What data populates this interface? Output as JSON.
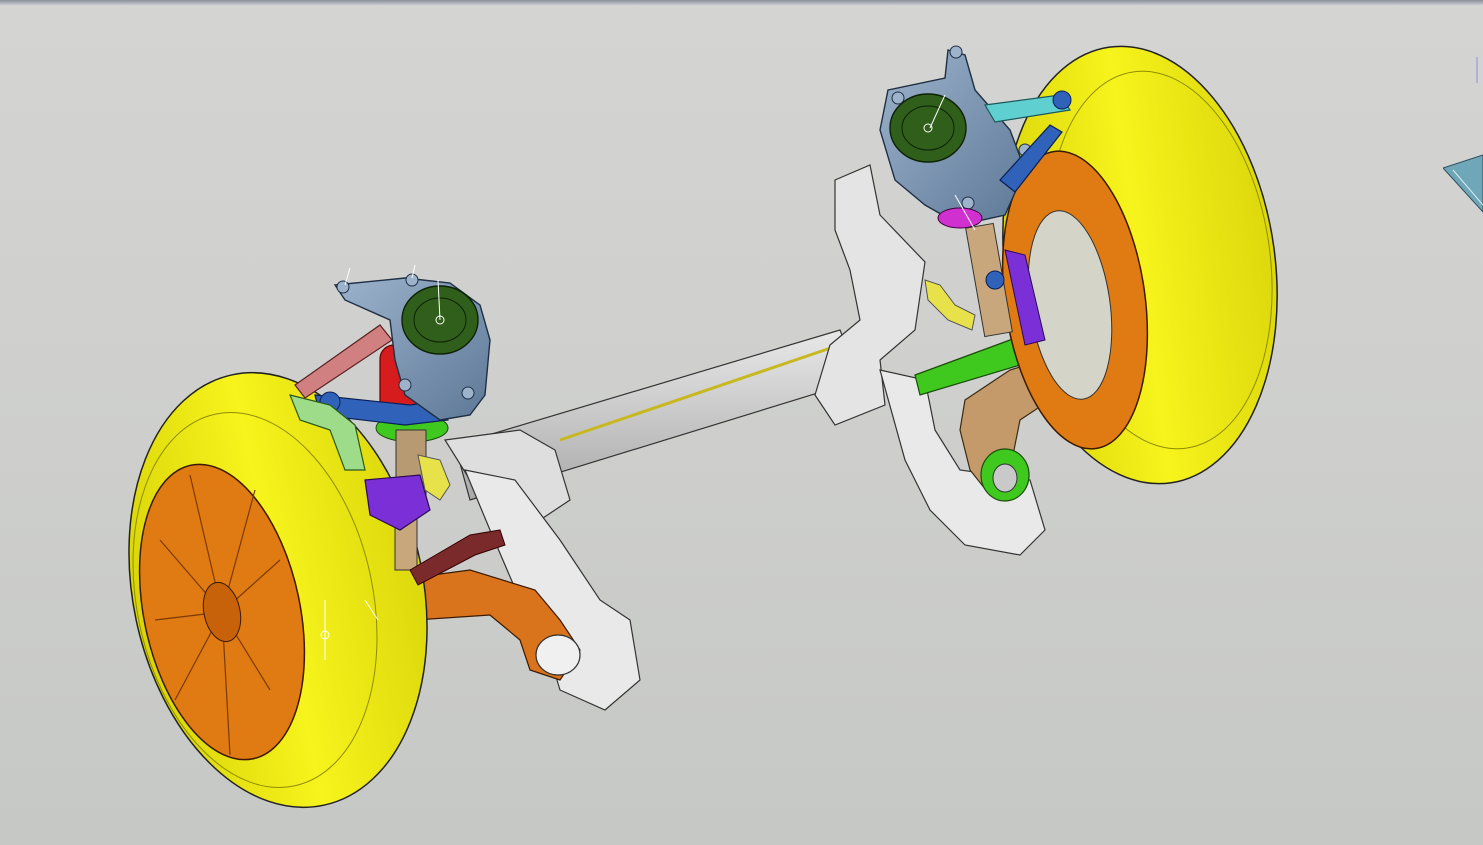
{
  "app": {
    "view": "3d-viewport"
  },
  "colors": {
    "background_top": "#d4d4d2",
    "background_bottom": "#c6c8c6",
    "tire": "#f2ee14",
    "rim": "#e07a12",
    "knuckle": "#7f99b8",
    "bushing": "#2f5f1a",
    "subframe": "#d8d8d8",
    "control_arm_brown": "#c49a6a",
    "lower_arm_orange": "#d9741c",
    "link_blue": "#2f62b8",
    "link_cyan": "#5fcfd0",
    "spring_red": "#d61c1c",
    "link_green": "#3fc81e",
    "link_purple": "#7b2fd6",
    "link_pink": "#d08080",
    "stabilizer_yellow": "#e8e24a",
    "compass": "#6fa7b8"
  },
  "icons": {
    "compass": "compass-icon"
  }
}
